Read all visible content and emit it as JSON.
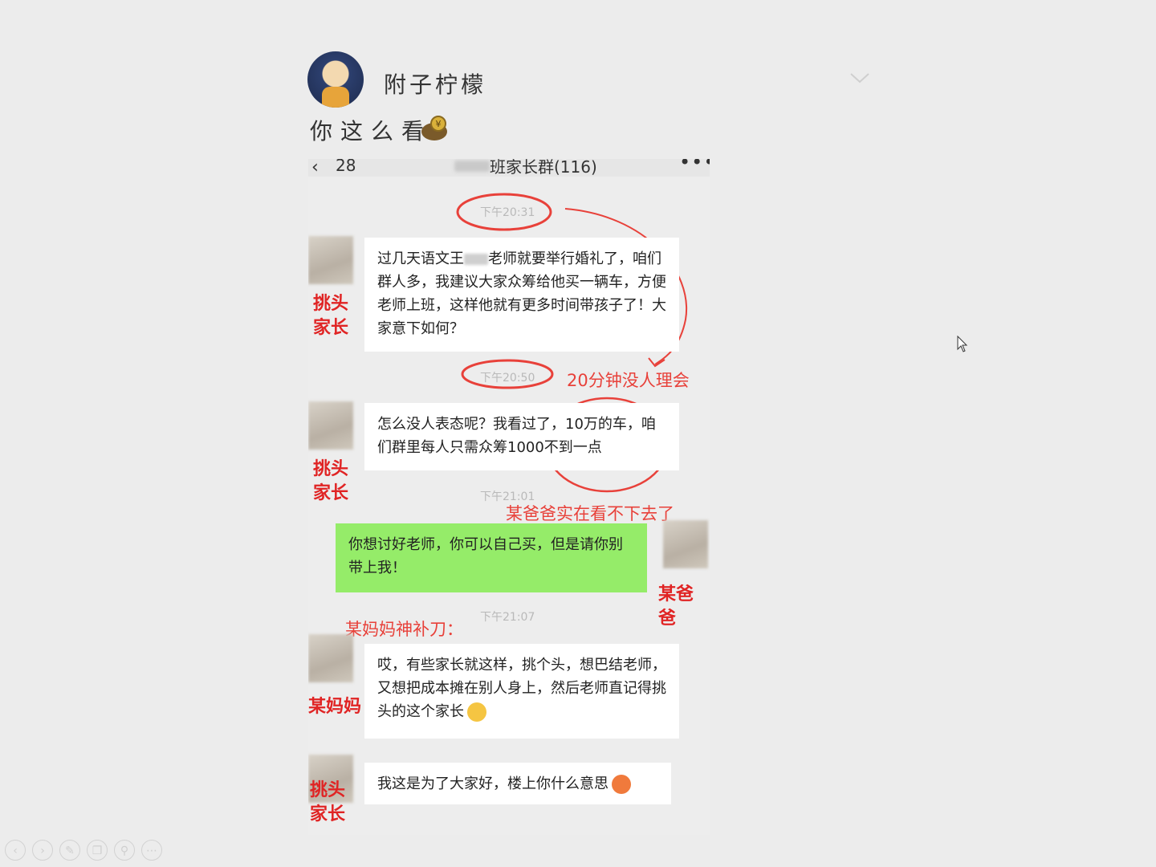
{
  "post": {
    "username": "附子柠檬",
    "text": "你这么看"
  },
  "chat": {
    "back_count": "28",
    "group_title": "班家长群(116)",
    "more_label": "•••",
    "messages": [
      {
        "time": "下午20:31",
        "sender_label": "挑头\n家长",
        "text_a": "过几天语文王",
        "text_b": "老师就要举行婚礼了，咱们群人多，我建议大家众筹给他买一辆车，方便老师上班，这样他就有更多时间带孩子了！大家意下如何？"
      },
      {
        "time": "下午20:50",
        "annotation": "20分钟没人理会",
        "sender_label": "挑头\n家长",
        "text": "怎么没人表态呢？我看过了，10万的车，咱们群里每人只需众筹1000不到一点"
      },
      {
        "time": "下午21:01",
        "annotation": "某爸爸实在看不下去了",
        "sender_label": "某爸爸",
        "text": "你想讨好老师，你可以自己买，但是请你别带上我！"
      },
      {
        "time": "下午21:07",
        "annotation": "某妈妈神补刀：",
        "sender_label": "某妈妈",
        "text": "哎，有些家长就这样，挑个头，想巴结老师，又想把成本摊在别人身上，然后老师直记得挑头的这个家长"
      },
      {
        "sender_label": "挑头\n家长",
        "text": "我这是为了大家好，楼上你什么意思"
      }
    ]
  },
  "icons": {
    "chevron": "chevron-down-icon",
    "cursor": "mouse-cursor-icon",
    "toolbar": [
      "prev-icon",
      "next-icon",
      "pen-icon",
      "copy-icon",
      "zoom-icon",
      "more-icon"
    ]
  }
}
